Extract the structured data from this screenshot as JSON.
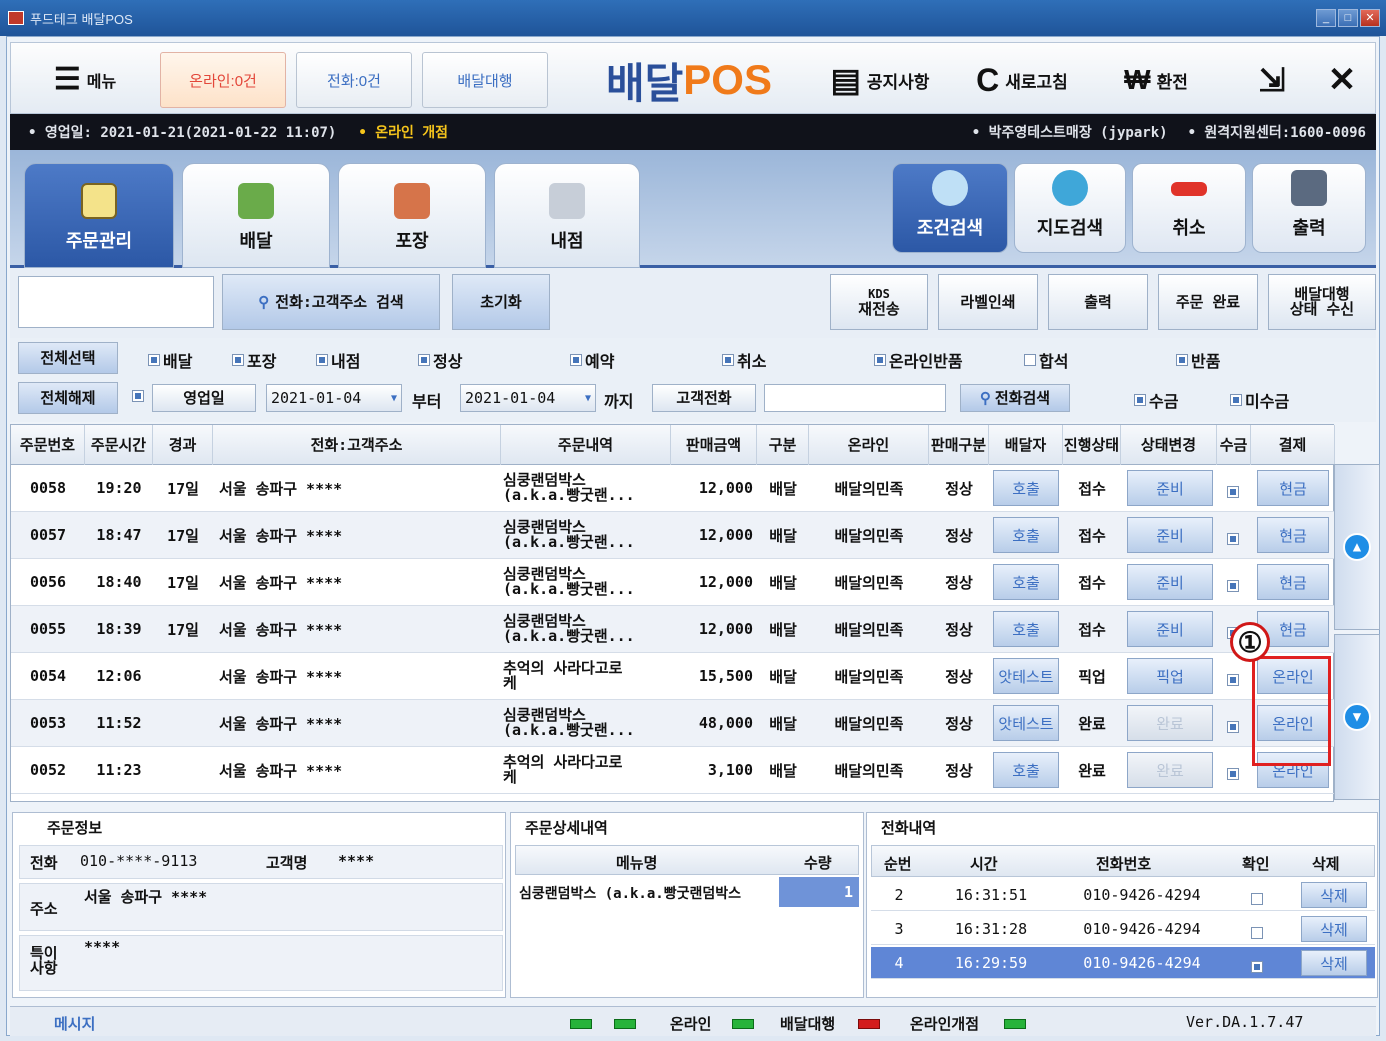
{
  "window": {
    "title": "푸드테크 배달POS"
  },
  "topbar": {
    "menu_label": "메뉴",
    "online_count": "온라인:0건",
    "phone_count": "전화:0건",
    "delivery_agency": "배달대행",
    "brand_prefix": "배달",
    "brand_suffix": "POS",
    "notice": "공지사항",
    "refresh": "새로고침",
    "exchange": "환전"
  },
  "infobar": {
    "business_date": "• 영업일: 2021-01-21(2021-01-22 11:07)",
    "online_status": "• 온라인 개점",
    "store": "• 박주영테스트매장 (jypark)",
    "support": "• 원격지원센터:1600-0096"
  },
  "tabs": [
    "주문관리",
    "배달",
    "포장",
    "내점"
  ],
  "tools": [
    "조건검색",
    "지도검색",
    "취소",
    "출력"
  ],
  "toolrow": {
    "phone_search": "전화:고객주소 검색",
    "reset": "초기화",
    "kds_line1": "KDS",
    "kds_line2": "재전송",
    "label_print": "라벨인쇄",
    "print": "출력",
    "order_complete": "주문 완료",
    "agency_line1": "배달대행",
    "agency_line2": "상태 수신"
  },
  "filter": {
    "select_all": "전체선택",
    "deselect_all": "전체해제",
    "types": [
      "배달",
      "포장",
      "내점"
    ],
    "status_normal": "정상",
    "reservation": "예약",
    "cancel": "취소",
    "online_return": "온라인반품",
    "combined": "합석",
    "return": "반품",
    "date_type": "영업일",
    "date_from": "2021-01-04",
    "from_label": "부터",
    "date_to": "2021-01-04",
    "to_label": "까지",
    "customer_phone": "고객전화",
    "phone_search_btn": "전화검색",
    "collected": "수금",
    "uncollected": "미수금"
  },
  "grid": {
    "headers": [
      "주문번호",
      "주문시간",
      "경과",
      "전화:고객주소",
      "주문내역",
      "판매금액",
      "구분",
      "온라인",
      "판매구분",
      "배달자",
      "진행상태",
      "상태변경",
      "수금",
      "결제"
    ],
    "rows": [
      {
        "no": "0058",
        "time": "19:20",
        "elapsed": "17일",
        "addr": "서울 송파구 ****",
        "item1": "심쿵랜덤박스",
        "item2": "(a.k.a.빵굿랜...",
        "amount": "12,000",
        "type": "배달",
        "online": "배달의민족",
        "sale": "정상",
        "driver": "호출",
        "status": "접수",
        "change": "준비",
        "pay": "현금"
      },
      {
        "no": "0057",
        "time": "18:47",
        "elapsed": "17일",
        "addr": "서울 송파구 ****",
        "item1": "심쿵랜덤박스",
        "item2": "(a.k.a.빵굿랜...",
        "amount": "12,000",
        "type": "배달",
        "online": "배달의민족",
        "sale": "정상",
        "driver": "호출",
        "status": "접수",
        "change": "준비",
        "pay": "현금"
      },
      {
        "no": "0056",
        "time": "18:40",
        "elapsed": "17일",
        "addr": "서울 송파구 ****",
        "item1": "심쿵랜덤박스",
        "item2": "(a.k.a.빵굿랜...",
        "amount": "12,000",
        "type": "배달",
        "online": "배달의민족",
        "sale": "정상",
        "driver": "호출",
        "status": "접수",
        "change": "준비",
        "pay": "현금"
      },
      {
        "no": "0055",
        "time": "18:39",
        "elapsed": "17일",
        "addr": "서울 송파구 ****",
        "item1": "심쿵랜덤박스",
        "item2": "(a.k.a.빵굿랜...",
        "amount": "12,000",
        "type": "배달",
        "online": "배달의민족",
        "sale": "정상",
        "driver": "호출",
        "status": "접수",
        "change": "준비",
        "pay": "현금"
      },
      {
        "no": "0054",
        "time": "12:06",
        "elapsed": "",
        "addr": "서울 송파구 ****",
        "item1": "추억의 사라다고로",
        "item2": "케",
        "amount": "15,500",
        "type": "배달",
        "online": "배달의민족",
        "sale": "정상",
        "driver": "앗테스트",
        "status": "픽업",
        "change": "픽업",
        "pay": "온라인"
      },
      {
        "no": "0053",
        "time": "11:52",
        "elapsed": "",
        "addr": "서울 송파구 ****",
        "item1": "심쿵랜덤박스",
        "item2": "(a.k.a.빵굿랜...",
        "amount": "48,000",
        "type": "배달",
        "online": "배달의민족",
        "sale": "정상",
        "driver": "앗테스트",
        "status": "완료",
        "change": "완료",
        "pay": "온라인"
      },
      {
        "no": "0052",
        "time": "11:23",
        "elapsed": "",
        "addr": "서울 송파구 ****",
        "item1": "추억의 사라다고로",
        "item2": "케",
        "amount": "3,100",
        "type": "배달",
        "online": "배달의민족",
        "sale": "정상",
        "driver": "호출",
        "status": "완료",
        "change": "완료",
        "pay": "온라인"
      }
    ]
  },
  "annotation": {
    "marker": "①"
  },
  "order_info": {
    "title": "주문정보",
    "phone_label": "전화",
    "phone": "010-****-9113",
    "name_label": "고객명",
    "name": "****",
    "addr_label": "주소",
    "addr": "서울 송파구 ****",
    "note_label1": "특이",
    "note_label2": "사항",
    "note": "****"
  },
  "order_detail": {
    "title": "주문상세내역",
    "col_menu": "메뉴명",
    "col_qty": "수량",
    "item": "심쿵랜덤박스 (a.k.a.빵굿랜덤박스",
    "qty": "1"
  },
  "call_log": {
    "title": "전화내역",
    "headers": [
      "순번",
      "시간",
      "전화번호",
      "확인",
      "삭제"
    ],
    "rows": [
      {
        "no": "2",
        "time": "16:31:51",
        "phone": "010-9426-4294",
        "del": "삭제"
      },
      {
        "no": "3",
        "time": "16:31:28",
        "phone": "010-9426-4294",
        "del": "삭제"
      },
      {
        "no": "4",
        "time": "16:29:59",
        "phone": "010-9426-4294",
        "del": "삭제"
      }
    ]
  },
  "status": {
    "message": "메시지",
    "online": "온라인",
    "agency": "배달대행",
    "online_open": "온라인개점",
    "version": "Ver.DA.1.7.47"
  },
  "colors": {
    "accent": "#2c58a6",
    "brand_orange": "#f07a1a",
    "highlight": "#e02020"
  }
}
